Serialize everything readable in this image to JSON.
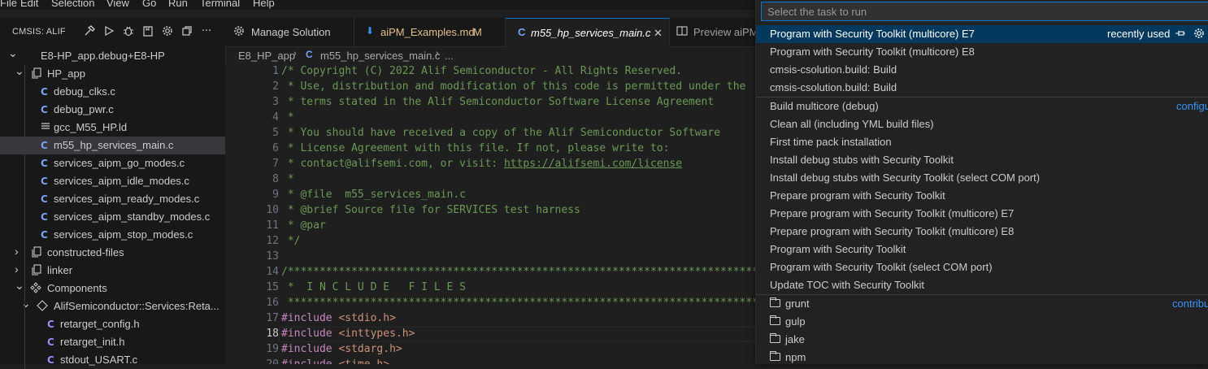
{
  "menu": [
    "File",
    "Edit",
    "Selection",
    "View",
    "Go",
    "Run",
    "Terminal",
    "Help"
  ],
  "sidebar": {
    "title": "CMSIS: ALIF",
    "toolbar_icons": [
      "hammer-icon",
      "play-icon",
      "debug-icon",
      "book-icon",
      "gear-icon",
      "split-icon",
      "ellipsis-icon"
    ],
    "tree": [
      {
        "label": "E8-HP_app.debug+E8-HP",
        "icon": "chevron-down",
        "indent": 0
      },
      {
        "label": "HP_app",
        "icon": "file-copy",
        "indent": 1
      },
      {
        "label": "debug_clks.c",
        "icon": "C",
        "indent": 2
      },
      {
        "label": "debug_pwr.c",
        "icon": "C",
        "indent": 2
      },
      {
        "label": "gcc_M55_HP.ld",
        "icon": "lines",
        "indent": 2
      },
      {
        "label": "m55_hp_services_main.c",
        "icon": "C",
        "indent": 2,
        "selected": true
      },
      {
        "label": "services_aipm_go_modes.c",
        "icon": "C",
        "indent": 2
      },
      {
        "label": "services_aipm_idle_modes.c",
        "icon": "C",
        "indent": 2
      },
      {
        "label": "services_aipm_ready_modes.c",
        "icon": "C",
        "indent": 2
      },
      {
        "label": "services_aipm_standby_modes.c",
        "icon": "C",
        "indent": 2
      },
      {
        "label": "services_aipm_stop_modes.c",
        "icon": "C",
        "indent": 2
      },
      {
        "label": "constructed-files",
        "icon": "file-copy",
        "indent": 1,
        "collapsed": true
      },
      {
        "label": "linker",
        "icon": "file-copy",
        "indent": 1,
        "collapsed": true
      },
      {
        "label": "Components",
        "icon": "component",
        "indent": 1
      },
      {
        "label": "AlifSemiconductor::Services:Reta...",
        "icon": "diamond",
        "indent": 2
      },
      {
        "label": "retarget_config.h",
        "icon": "C",
        "indent": 3
      },
      {
        "label": "retarget_init.h",
        "icon": "C",
        "indent": 3
      },
      {
        "label": "stdout_USART.c",
        "icon": "C",
        "indent": 3
      }
    ]
  },
  "tabs": [
    {
      "label": "Manage Solution",
      "icon": "gear-icon"
    },
    {
      "label": "aiPM_Examples.md",
      "badge": "M",
      "icon": "markdown-icon"
    },
    {
      "label": "m55_hp_services_main.c",
      "icon": "c-file-icon",
      "active": true,
      "close": "✕"
    },
    {
      "label": "Preview aiPM",
      "icon": "preview-icon"
    }
  ],
  "breadcrumb": {
    "folder": "E8_HP_app",
    "file": "m55_hp_services_main.c",
    "more": "..."
  },
  "editor": {
    "current_line": 18,
    "lines": [
      {
        "n": 1,
        "text": "/* Copyright (C) 2022 Alif Semiconductor - All Rights Reserved.",
        "t": "cm"
      },
      {
        "n": 2,
        "text": " * Use, distribution and modification of this code is permitted under the",
        "t": "cm"
      },
      {
        "n": 3,
        "text": " * terms stated in the Alif Semiconductor Software License Agreement",
        "t": "cm"
      },
      {
        "n": 4,
        "text": " *",
        "t": "cm"
      },
      {
        "n": 5,
        "text": " * You should have received a copy of the Alif Semiconductor Software",
        "t": "cm"
      },
      {
        "n": 6,
        "text": " * License Agreement with this file. If not, please write to:",
        "t": "cm"
      },
      {
        "n": 7,
        "text": " * contact@alifsemi.com, or visit: ",
        "t": "cm",
        "link": "https://alifsemi.com/license"
      },
      {
        "n": 8,
        "text": " *",
        "t": "cm"
      },
      {
        "n": 9,
        "text": " * @file  m55_services_main.c",
        "t": "cm"
      },
      {
        "n": 10,
        "text": " * @brief Source file for SERVICES test harness",
        "t": "cm"
      },
      {
        "n": 11,
        "text": " * @par",
        "t": "cm"
      },
      {
        "n": 12,
        "text": " */",
        "t": "cm"
      },
      {
        "n": 13,
        "text": "",
        "t": "cm"
      },
      {
        "n": 14,
        "text": "/**********************************************************************************",
        "t": "cm"
      },
      {
        "n": 15,
        "text": " *  I N C L U D E   F I L E S",
        "t": "cm"
      },
      {
        "n": 16,
        "text": " *********************************************************************************",
        "t": "cm"
      },
      {
        "n": 17,
        "kw": "#include",
        "inc": " <stdio.h>",
        "t": "inc"
      },
      {
        "n": 18,
        "kw": "#include",
        "inc": " <inttypes.h>",
        "t": "inc"
      },
      {
        "n": 19,
        "kw": "#include",
        "inc": " <stdarg.h>",
        "t": "inc"
      },
      {
        "n": 20,
        "kw": "#include",
        "inc": " <time.h>",
        "t": "inc"
      }
    ]
  },
  "quickpick": {
    "placeholder": "Select the task to run",
    "groups": [
      {
        "items": [
          {
            "label": "Program with Security Toolkit (multicore) E7",
            "right": "recently used",
            "active": true,
            "icons": [
              "pin-icon",
              "gear-icon"
            ]
          },
          {
            "label": "Program with Security Toolkit (multicore) E8"
          },
          {
            "label": "cmsis-csolution.build: Build"
          },
          {
            "label": "cmsis-csolution.build: Build"
          }
        ]
      },
      {
        "items": [
          {
            "label": "Build multicore (debug)",
            "right": "configu"
          },
          {
            "label": "Clean all (including YML build files)"
          },
          {
            "label": "First time pack installation"
          },
          {
            "label": "Install debug stubs with Security Toolkit"
          },
          {
            "label": "Install debug stubs with Security Toolkit (select COM port)"
          },
          {
            "label": "Prepare program with Security Toolkit"
          },
          {
            "label": "Prepare program with Security Toolkit (multicore) E7"
          },
          {
            "label": "Prepare program with Security Toolkit (multicore) E8"
          },
          {
            "label": "Program with Security Toolkit"
          },
          {
            "label": "Program with Security Toolkit (select COM port)"
          },
          {
            "label": "Update TOC with Security Toolkit"
          }
        ]
      },
      {
        "items": [
          {
            "label": "grunt",
            "folder": true,
            "right": "contribu"
          },
          {
            "label": "gulp",
            "folder": true
          },
          {
            "label": "jake",
            "folder": true
          },
          {
            "label": "npm",
            "folder": true
          }
        ]
      }
    ]
  },
  "colors": {
    "accent": "#0078d4",
    "selection": "#04395e",
    "comment": "#6a9955",
    "keyword": "#c586c0",
    "string": "#ce9178",
    "link": "#3794ff",
    "c_icon": "#9b8cff"
  }
}
